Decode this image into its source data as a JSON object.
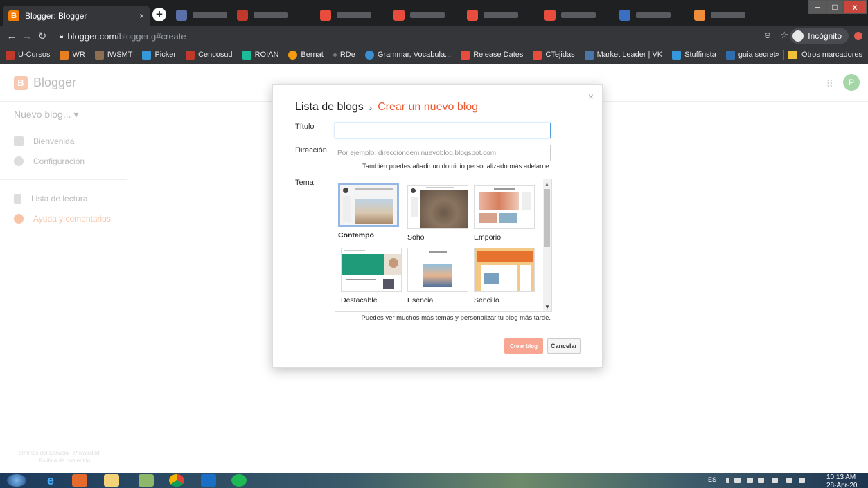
{
  "browser": {
    "active_tab_title": "Blogger: Blogger",
    "tab_close": "×",
    "new_tab": "+",
    "window_controls": {
      "minimize": "–",
      "maximize": "□",
      "close": "x"
    },
    "url_host": "blogger.com",
    "url_path": "/blogger.g#create",
    "incognito_label": "Incógnito",
    "bookmarks": [
      {
        "label": "U-Cursos",
        "color": "#c0392b"
      },
      {
        "label": "WR",
        "color": "#e67e22"
      },
      {
        "label": "IWSMT",
        "color": "#8e6e53"
      },
      {
        "label": "Picker",
        "color": "#3498db"
      },
      {
        "label": "Cencosud",
        "color": "#c0392b"
      },
      {
        "label": "ROIAN",
        "color": "#1abc9c"
      },
      {
        "label": "Bernat",
        "color": "#f39c12"
      },
      {
        "label": "RDe",
        "color": "#777777"
      },
      {
        "label": "Grammar, Vocabula...",
        "color": "#3b8ed0"
      },
      {
        "label": "Release Dates",
        "color": "#e74c3c"
      },
      {
        "label": "CTejidas",
        "color": "#e74c3c"
      },
      {
        "label": "Market Leader | VK",
        "color": "#4a76a8"
      },
      {
        "label": "Stuffinsta",
        "color": "#3498db"
      },
      {
        "label": "guia secret",
        "color": "#2f6fb0"
      }
    ],
    "bookmarks_overflow": "»",
    "other_bookmarks": "Otros marcadores"
  },
  "app": {
    "logo_text": "Blogger",
    "avatar_letter": "P",
    "new_blog_label": "Nuevo blog... ▾",
    "sidebar": [
      {
        "label": "Bienvenida"
      },
      {
        "label": "Configuración"
      },
      {
        "label": "Lista de lectura"
      },
      {
        "label": "Ayuda y comentarios"
      }
    ],
    "footer": {
      "line1": "Términos del Servicio  ·  Privacidad",
      "line2": "Política de contenido"
    }
  },
  "dialog": {
    "close": "×",
    "breadcrumb_parent": "Lista de blogs",
    "breadcrumb_sep": "›",
    "breadcrumb_current": "Crear un nuevo blog",
    "titulo_label": "Título",
    "titulo_value": "",
    "direccion_label": "Dirección",
    "direccion_placeholder": "Por ejemplo: direccióndeminuevoblog.blogspot.com",
    "direccion_hint": "También puedes añadir un dominio personalizado más adelante.",
    "tema_label": "Tema",
    "themes": [
      {
        "name": "Contempo",
        "selected": true
      },
      {
        "name": "Soho",
        "selected": false
      },
      {
        "name": "Emporio",
        "selected": false
      },
      {
        "name": "Destacable",
        "selected": false
      },
      {
        "name": "Esencial",
        "selected": false
      },
      {
        "name": "Sencillo",
        "selected": false
      }
    ],
    "themes_hint": "Puedes ver muchos más temas y personalizar tu blog más tarde.",
    "create_label": "Crear blog",
    "cancel_label": "Cancelar"
  },
  "taskbar": {
    "lang": "ES",
    "time": "10:13 AM",
    "date": "28-Apr-20"
  }
}
